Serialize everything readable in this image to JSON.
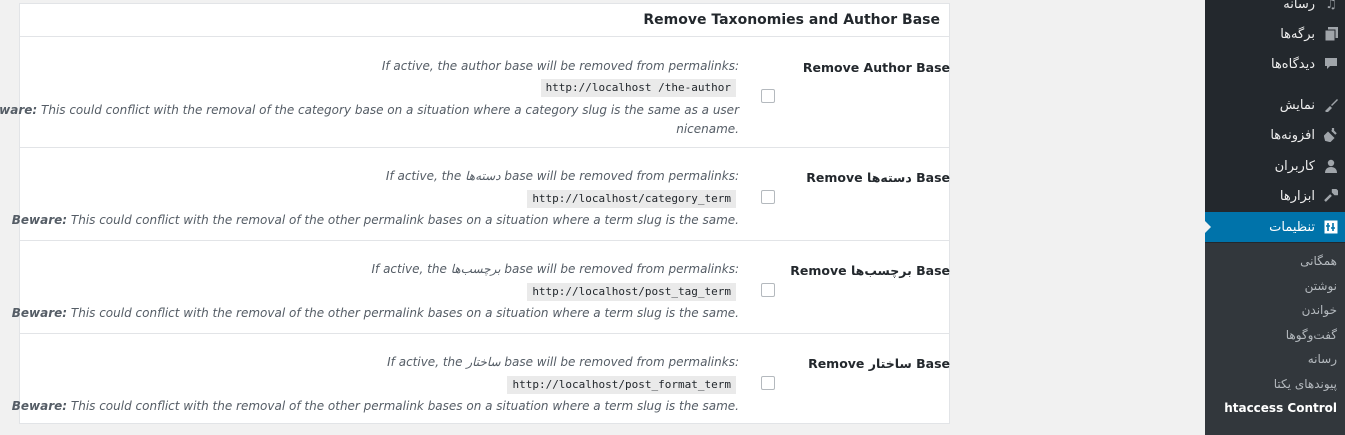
{
  "panel": {
    "title": "Remove Taxonomies and Author Base",
    "rows": [
      {
        "label": "Remove Author Base",
        "desc": "If active, the author base will be removed from permalinks:",
        "code": "http://localhost /the-author",
        "beware": "Beware:",
        "warn_rest": " This could conflict with the removal of the category base on a situation where a category slug is the same as a user",
        "warn_line2": "nicename."
      },
      {
        "label": "Remove دسته‌ها Base",
        "desc": "If active, the دسته‌ها base will be removed from permalinks:",
        "code": "http://localhost/category_term",
        "beware": "Beware:",
        "warn_rest": " This could conflict with the removal of the other permalink bases on a situation where a term slug is the same."
      },
      {
        "label": "Remove برچسب‌ها Base",
        "desc": "If active, the برچسب‌ها base will be removed from permalinks:",
        "code": "http://localhost/post_tag_term",
        "beware": "Beware:",
        "warn_rest": " This could conflict with the removal of the other permalink bases on a situation where a term slug is the same."
      },
      {
        "label": "Remove ساختار Base",
        "desc": "If active, the ساختار base will be removed from permalinks:",
        "code": "http://localhost/post_format_term",
        "beware": "Beware:",
        "warn_rest": " This could conflict with the removal of the other permalink bases on a situation where a term slug is the same."
      }
    ]
  },
  "sidebar": {
    "items": [
      {
        "label": "رسانه",
        "icon": "media-icon"
      },
      {
        "label": "برگه‌ها",
        "icon": "pages-icon"
      },
      {
        "label": "دیدگاه‌ها",
        "icon": "comments-icon"
      },
      {
        "label": "نمایش",
        "icon": "appearance-icon"
      },
      {
        "label": "افزونه‌ها",
        "icon": "plugins-icon"
      },
      {
        "label": "کاربران",
        "icon": "users-icon"
      },
      {
        "label": "ابزارها",
        "icon": "tools-icon"
      },
      {
        "label": "تنظیمات",
        "icon": "settings-icon"
      }
    ],
    "submenu": [
      {
        "label": "همگانی"
      },
      {
        "label": "نوشتن"
      },
      {
        "label": "خواندن"
      },
      {
        "label": "گفت‌وگوها"
      },
      {
        "label": "رسانه"
      },
      {
        "label": "پیوندهای یکتا"
      },
      {
        "label": "htaccess Control"
      }
    ],
    "colors": {
      "background": "#23282d",
      "active": "#0073aa",
      "submenu_bg": "#32373c"
    }
  }
}
